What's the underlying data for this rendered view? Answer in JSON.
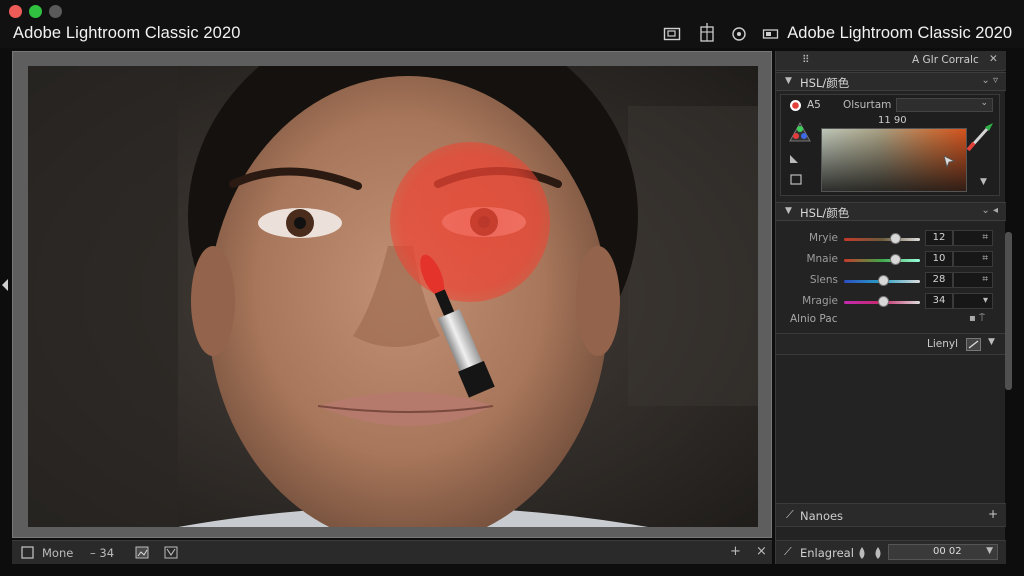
{
  "window": {
    "title_left": "Adobe Lightroom Classic 2020",
    "title_right": "Adobe Lightroom Classic 2020"
  },
  "toolbar_icons": [
    "crop-icon",
    "trash-icon",
    "target-icon",
    "battery-icon"
  ],
  "panel": {
    "top_label": "A GIr Corralc",
    "section1": {
      "title": "HSL/颜色",
      "right": "⌄ ▿"
    },
    "color": {
      "mode_label": "A5",
      "dropdown_label": "Olsurtam",
      "readout": "11 90"
    },
    "section2": {
      "title": "HSL/颜色",
      "right": "⌄ ◂"
    },
    "sliders": [
      {
        "name": "Mryie",
        "value": "12",
        "stepper": "⌗",
        "position": 0.68
      },
      {
        "name": "Mnaie",
        "value": "10",
        "stepper": "⌗",
        "position": 0.68
      },
      {
        "name": "Slens",
        "value": "28",
        "stepper": "⌗",
        "position": 0.52
      },
      {
        "name": "Mragie",
        "value": "34",
        "stepper": "▾",
        "position": 0.52
      }
    ],
    "auto_label": "Alnio Pac",
    "legend_label": "Lienyl",
    "nanoes_label": "Nanoes",
    "footer_label": "Enlagreal",
    "footer_value": "00 02"
  },
  "bottom": {
    "item1": "Mone",
    "item2": "– 34",
    "right_plus": "+",
    "right_close": "×"
  },
  "colors": {
    "brush_overlay": "#ee4433",
    "accent_red": "#e2413a",
    "panel_bg": "#232323"
  }
}
